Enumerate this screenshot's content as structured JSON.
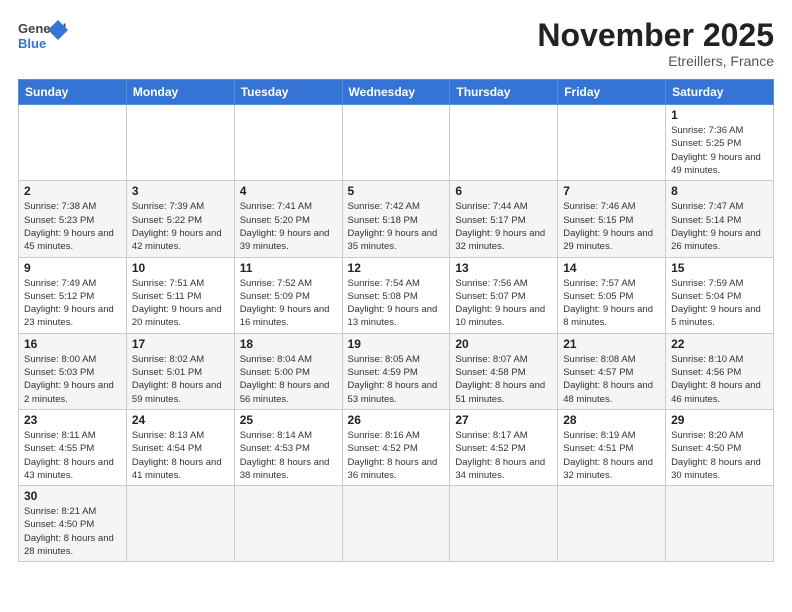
{
  "header": {
    "logo_general": "General",
    "logo_blue": "Blue",
    "month_title": "November 2025",
    "location": "Etreillers, France"
  },
  "weekdays": [
    "Sunday",
    "Monday",
    "Tuesday",
    "Wednesday",
    "Thursday",
    "Friday",
    "Saturday"
  ],
  "weeks": [
    [
      {
        "day": "",
        "info": ""
      },
      {
        "day": "",
        "info": ""
      },
      {
        "day": "",
        "info": ""
      },
      {
        "day": "",
        "info": ""
      },
      {
        "day": "",
        "info": ""
      },
      {
        "day": "",
        "info": ""
      },
      {
        "day": "1",
        "info": "Sunrise: 7:36 AM\nSunset: 5:25 PM\nDaylight: 9 hours and 49 minutes."
      }
    ],
    [
      {
        "day": "2",
        "info": "Sunrise: 7:38 AM\nSunset: 5:23 PM\nDaylight: 9 hours and 45 minutes."
      },
      {
        "day": "3",
        "info": "Sunrise: 7:39 AM\nSunset: 5:22 PM\nDaylight: 9 hours and 42 minutes."
      },
      {
        "day": "4",
        "info": "Sunrise: 7:41 AM\nSunset: 5:20 PM\nDaylight: 9 hours and 39 minutes."
      },
      {
        "day": "5",
        "info": "Sunrise: 7:42 AM\nSunset: 5:18 PM\nDaylight: 9 hours and 35 minutes."
      },
      {
        "day": "6",
        "info": "Sunrise: 7:44 AM\nSunset: 5:17 PM\nDaylight: 9 hours and 32 minutes."
      },
      {
        "day": "7",
        "info": "Sunrise: 7:46 AM\nSunset: 5:15 PM\nDaylight: 9 hours and 29 minutes."
      },
      {
        "day": "8",
        "info": "Sunrise: 7:47 AM\nSunset: 5:14 PM\nDaylight: 9 hours and 26 minutes."
      }
    ],
    [
      {
        "day": "9",
        "info": "Sunrise: 7:49 AM\nSunset: 5:12 PM\nDaylight: 9 hours and 23 minutes."
      },
      {
        "day": "10",
        "info": "Sunrise: 7:51 AM\nSunset: 5:11 PM\nDaylight: 9 hours and 20 minutes."
      },
      {
        "day": "11",
        "info": "Sunrise: 7:52 AM\nSunset: 5:09 PM\nDaylight: 9 hours and 16 minutes."
      },
      {
        "day": "12",
        "info": "Sunrise: 7:54 AM\nSunset: 5:08 PM\nDaylight: 9 hours and 13 minutes."
      },
      {
        "day": "13",
        "info": "Sunrise: 7:56 AM\nSunset: 5:07 PM\nDaylight: 9 hours and 10 minutes."
      },
      {
        "day": "14",
        "info": "Sunrise: 7:57 AM\nSunset: 5:05 PM\nDaylight: 9 hours and 8 minutes."
      },
      {
        "day": "15",
        "info": "Sunrise: 7:59 AM\nSunset: 5:04 PM\nDaylight: 9 hours and 5 minutes."
      }
    ],
    [
      {
        "day": "16",
        "info": "Sunrise: 8:00 AM\nSunset: 5:03 PM\nDaylight: 9 hours and 2 minutes."
      },
      {
        "day": "17",
        "info": "Sunrise: 8:02 AM\nSunset: 5:01 PM\nDaylight: 8 hours and 59 minutes."
      },
      {
        "day": "18",
        "info": "Sunrise: 8:04 AM\nSunset: 5:00 PM\nDaylight: 8 hours and 56 minutes."
      },
      {
        "day": "19",
        "info": "Sunrise: 8:05 AM\nSunset: 4:59 PM\nDaylight: 8 hours and 53 minutes."
      },
      {
        "day": "20",
        "info": "Sunrise: 8:07 AM\nSunset: 4:58 PM\nDaylight: 8 hours and 51 minutes."
      },
      {
        "day": "21",
        "info": "Sunrise: 8:08 AM\nSunset: 4:57 PM\nDaylight: 8 hours and 48 minutes."
      },
      {
        "day": "22",
        "info": "Sunrise: 8:10 AM\nSunset: 4:56 PM\nDaylight: 8 hours and 46 minutes."
      }
    ],
    [
      {
        "day": "23",
        "info": "Sunrise: 8:11 AM\nSunset: 4:55 PM\nDaylight: 8 hours and 43 minutes."
      },
      {
        "day": "24",
        "info": "Sunrise: 8:13 AM\nSunset: 4:54 PM\nDaylight: 8 hours and 41 minutes."
      },
      {
        "day": "25",
        "info": "Sunrise: 8:14 AM\nSunset: 4:53 PM\nDaylight: 8 hours and 38 minutes."
      },
      {
        "day": "26",
        "info": "Sunrise: 8:16 AM\nSunset: 4:52 PM\nDaylight: 8 hours and 36 minutes."
      },
      {
        "day": "27",
        "info": "Sunrise: 8:17 AM\nSunset: 4:52 PM\nDaylight: 8 hours and 34 minutes."
      },
      {
        "day": "28",
        "info": "Sunrise: 8:19 AM\nSunset: 4:51 PM\nDaylight: 8 hours and 32 minutes."
      },
      {
        "day": "29",
        "info": "Sunrise: 8:20 AM\nSunset: 4:50 PM\nDaylight: 8 hours and 30 minutes."
      }
    ],
    [
      {
        "day": "30",
        "info": "Sunrise: 8:21 AM\nSunset: 4:50 PM\nDaylight: 8 hours and 28 minutes."
      },
      {
        "day": "",
        "info": ""
      },
      {
        "day": "",
        "info": ""
      },
      {
        "day": "",
        "info": ""
      },
      {
        "day": "",
        "info": ""
      },
      {
        "day": "",
        "info": ""
      },
      {
        "day": "",
        "info": ""
      }
    ]
  ]
}
